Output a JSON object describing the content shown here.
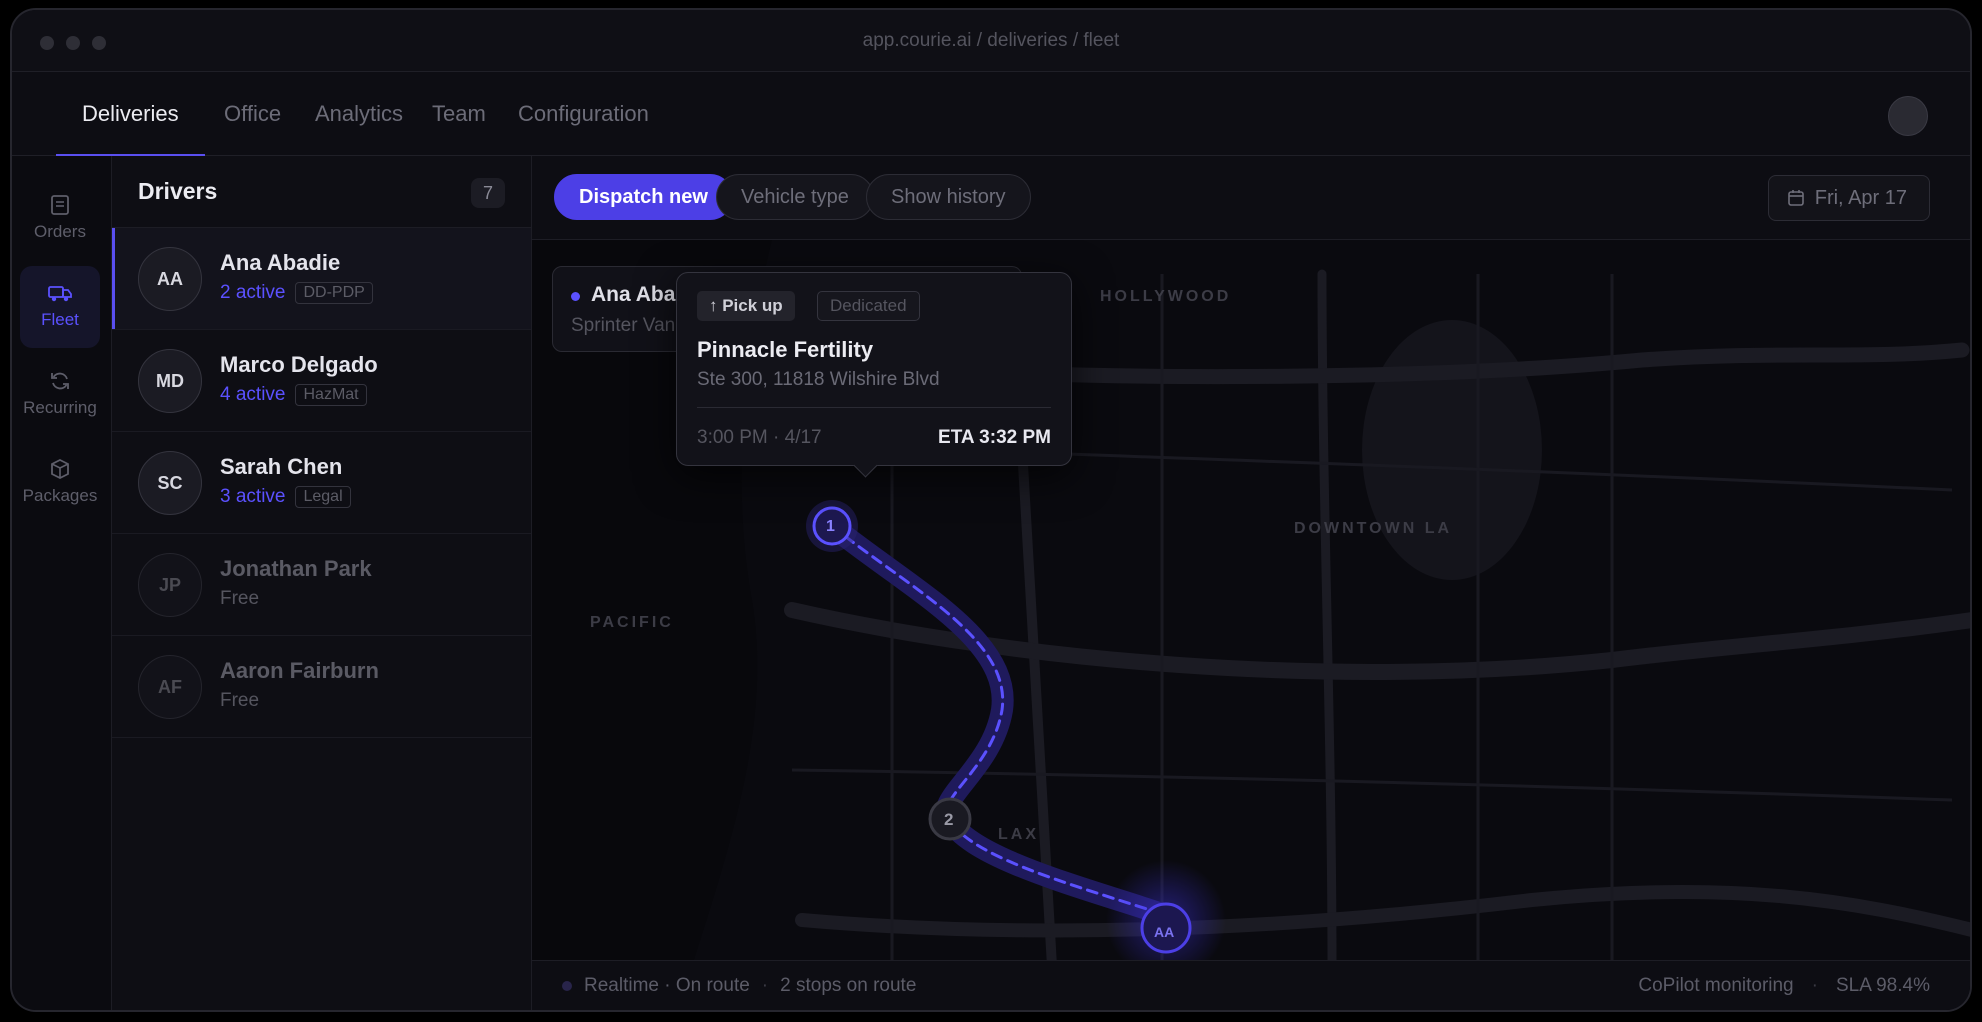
{
  "window": {
    "url": "app.courie.ai / deliveries / fleet"
  },
  "topnav": {
    "tabs": [
      {
        "label": "Deliveries",
        "active": true
      },
      {
        "label": "Office"
      },
      {
        "label": "Analytics"
      },
      {
        "label": "Team"
      },
      {
        "label": "Configuration"
      }
    ]
  },
  "rail": {
    "items": [
      {
        "label": "Orders",
        "icon": "document-icon"
      },
      {
        "label": "Fleet",
        "icon": "truck-icon",
        "active": true
      },
      {
        "label": "Recurring",
        "icon": "refresh-icon"
      },
      {
        "label": "Packages",
        "icon": "box-icon"
      }
    ]
  },
  "drivers": {
    "title": "Drivers",
    "count": "7",
    "list": [
      {
        "initials": "AA",
        "name": "Ana Abadie",
        "status": "2 active",
        "tag": "DD-PDP",
        "selected": true
      },
      {
        "initials": "MD",
        "name": "Marco Delgado",
        "status": "4 active",
        "tag": "HazMat"
      },
      {
        "initials": "SC",
        "name": "Sarah Chen",
        "status": "3 active",
        "tag": "Legal"
      },
      {
        "initials": "JP",
        "name": "Jonathan Park",
        "status": "Free"
      },
      {
        "initials": "AF",
        "name": "Aaron Fairburn",
        "status": "Free"
      }
    ]
  },
  "toolbar": {
    "dispatch_label": "Dispatch new",
    "vehicle_label": "Vehicle type",
    "history_label": "Show history",
    "date_label": "Fri, Apr 17"
  },
  "map": {
    "labels": {
      "hollywood": "HOLLYWOOD",
      "downtown": "DOWNTOWN LA",
      "pacific": "PACIFIC",
      "lax": "LAX"
    },
    "route_card": {
      "driver": "Ana Abadie",
      "vehicle": "Sprinter Van · "
    },
    "stops": [
      "1",
      "2"
    ],
    "driver_marker": "AA",
    "popup": {
      "pickup_label": "↑ Pick up",
      "service_label": "Dedicated",
      "title": "Pinnacle Fertility",
      "address": "Ste 300, 11818 Wilshire Blvd",
      "time": "3:00 PM · 4/17",
      "eta": "ETA 3:32 PM"
    }
  },
  "status": {
    "realtime": "Realtime · On route",
    "stops": "2 stops on route",
    "monitoring": "CoPilot monitoring",
    "sla": "SLA 98.4%"
  },
  "colors": {
    "accent": "#5b51ff",
    "primary_button": "#4c3fe6",
    "background": "#0a0a0f"
  }
}
